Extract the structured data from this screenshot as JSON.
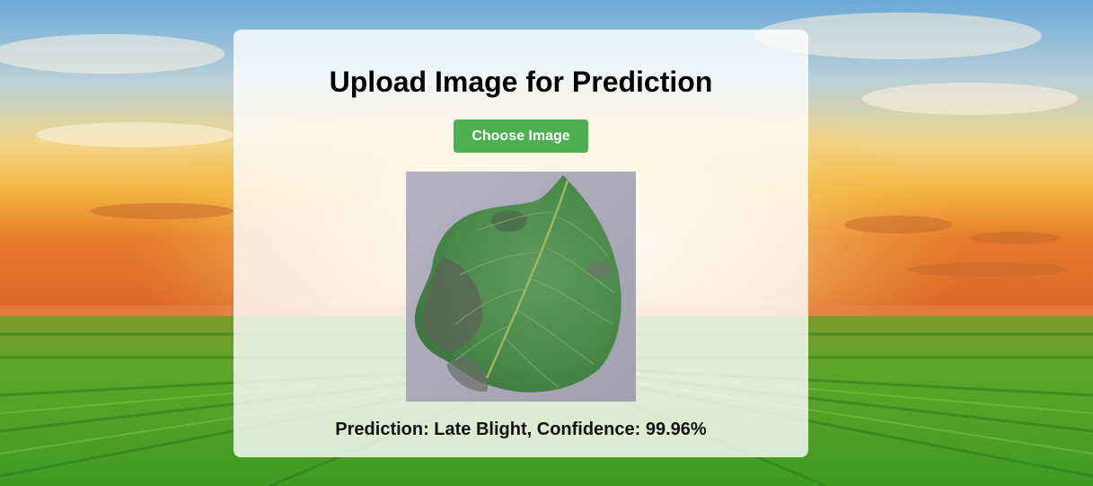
{
  "page": {
    "title": "Upload Image for Prediction",
    "choose_button_label": "Choose Image",
    "prediction_text": "Prediction: Late Blight, Confidence: 99.96%"
  },
  "colors": {
    "button_bg": "#4caf50",
    "button_text": "#ffffff",
    "card_bg": "rgba(255,255,255,0.80)"
  },
  "preview_image": {
    "subject": "potato leaf with late blight lesions"
  }
}
